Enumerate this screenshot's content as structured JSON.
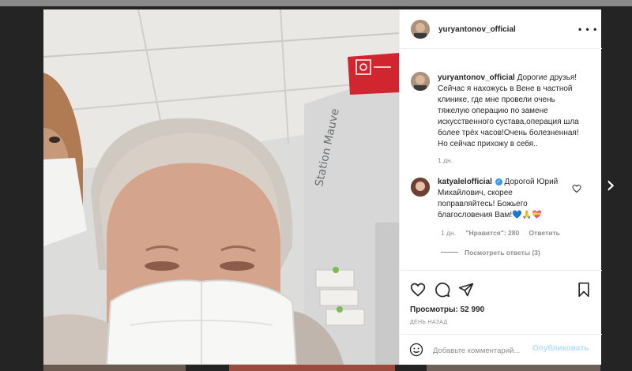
{
  "post": {
    "author": "yuryantonov_official",
    "caption": "Дорогие друзья!Сейчас я нахожусь в Вене в частной клинике, где мне провели очень тяжелую операцию по замене искусственного сустава,операция шла более трёх часов!Очень болезненная!Но сейчас прихожу в себя..",
    "caption_time": "1 дн.",
    "views_label": "Просмотры:",
    "views_count": "52 990",
    "date_label": "ДЕНЬ НАЗАД"
  },
  "comment": {
    "author": "katyalelofficial",
    "text": "Дорогой Юрий Михайлович, скорее поправляйтесь! Божьего благословения Вам!💙🙏💝",
    "time": "1 дн.",
    "likes": "\"Нравится\": 280",
    "reply_label": "Ответить",
    "view_replies": "Посмотреть ответы (3)"
  },
  "comment_box": {
    "placeholder": "Добавьте комментарий...",
    "publish_label": "Опубликовать"
  },
  "icons": {
    "more": "more-options-icon",
    "like": "heart-icon",
    "comment": "comment-icon",
    "share": "share-icon",
    "save": "bookmark-icon",
    "emoji": "emoji-icon",
    "mute": "audio-muted-icon",
    "next": "chevron-right-icon"
  },
  "media": {
    "sign_text": "Station Mauve"
  }
}
